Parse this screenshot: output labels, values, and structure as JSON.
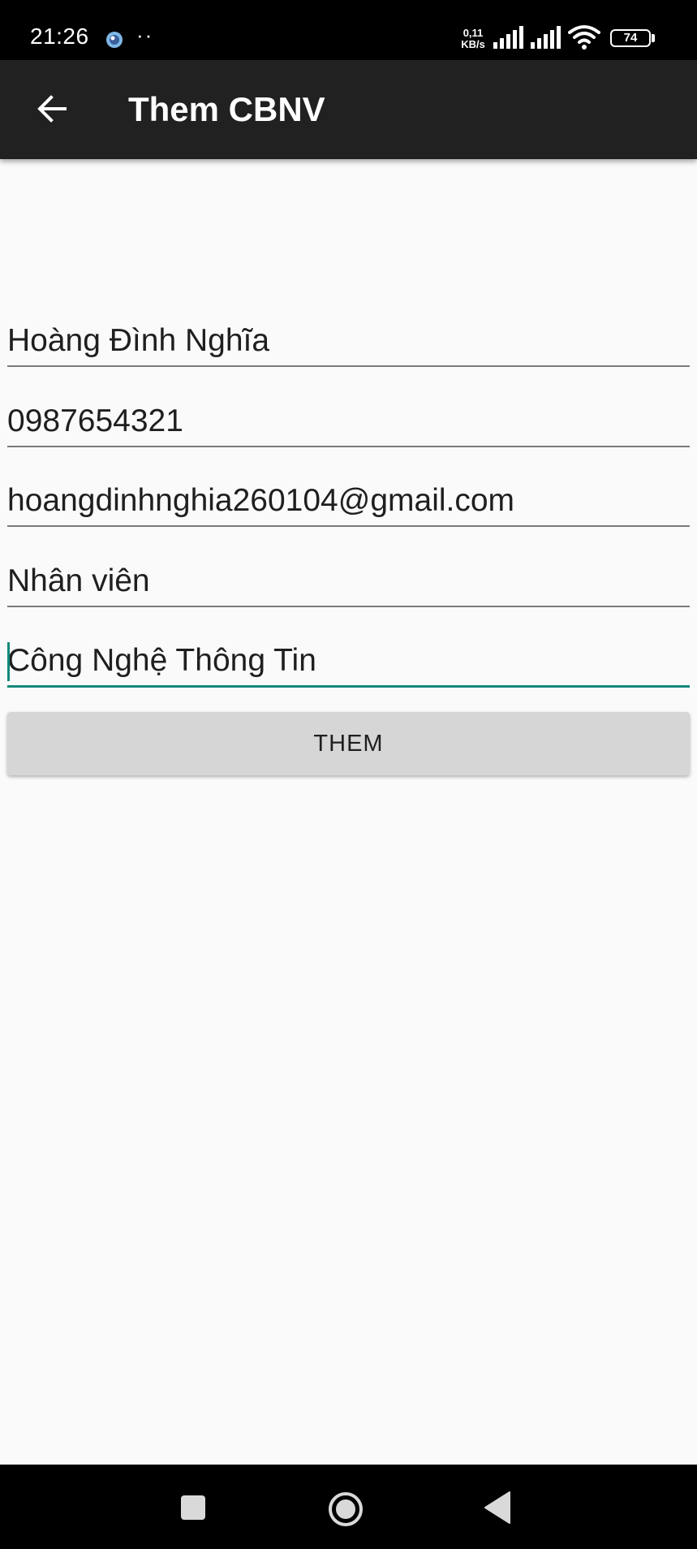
{
  "status_bar": {
    "time": "21:26",
    "dots": "··",
    "net_speed_value": "0,11",
    "net_speed_unit": "KB/s",
    "battery_level": "74",
    "icons": [
      "app-notification-icon",
      "signal-icon",
      "signal-icon",
      "wifi-icon",
      "battery-icon"
    ]
  },
  "app_bar": {
    "title": "Them CBNV",
    "back_icon": "arrow-left-icon",
    "background": "#212121"
  },
  "form": {
    "fields": [
      {
        "name": "full-name",
        "value": "Hoàng Đình Nghĩa"
      },
      {
        "name": "phone",
        "value": "0987654321"
      },
      {
        "name": "email",
        "value": "hoangdinhnghia260104@gmail.com"
      },
      {
        "name": "position",
        "value": "Nhân viên"
      },
      {
        "name": "department",
        "value": "Công Nghệ Thông Tin",
        "focused": true
      }
    ],
    "submit_label": "THEM",
    "accent_color": "#12887a"
  },
  "nav_bar": {
    "icons": [
      "square-recents-icon",
      "circle-home-icon",
      "triangle-back-icon"
    ]
  }
}
